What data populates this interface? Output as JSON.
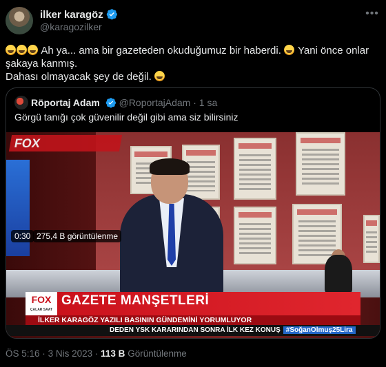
{
  "author": {
    "name": "ilker karagöz",
    "handle": "@karagozilker"
  },
  "tweet": {
    "line1": "Ah ya... ama bir gazeteden okuduğumuz bir haberdi.",
    "line1b": "Yani önce onlar",
    "line2": "şakaya kanmış.",
    "line3": "Dahası olmayacak şey de değil."
  },
  "quoted": {
    "name": "Röportaj Adam",
    "handle": "@RoportajAdam",
    "dot": "·",
    "time": "1 sa",
    "text": "Görgü tanığı çok güvenilir değil gibi ama siz bilirsiniz"
  },
  "video": {
    "bg_logo": "FOX",
    "lower_third_logo": "FOX",
    "lower_third_logo_sub": "ÇALAR SAAT",
    "lower_third_title": "GAZETE MANŞETLERİ",
    "lower_third_sub": "İLKER KARAGÖZ YAZILI BASININ GÜNDEMİNİ YORUMLUYOR",
    "ticker_text": "DEDEN YSK KARARINDAN SONRA İLK KEZ KONUŞ",
    "ticker_hashtag": "#SoğanOlmuş25Lira",
    "duration": "0:30",
    "views": "275,4 B görüntülenme"
  },
  "footer": {
    "time": "ÖS 5:16",
    "sep": "·",
    "date": "3 Nis 2023",
    "sep2": "·",
    "views_count": "113 B",
    "views_label": "Görüntülenme"
  },
  "colors": {
    "background": "#000000",
    "text": "#e7e9ea",
    "muted": "#71767b",
    "verified": "#1d9bf0",
    "border": "#2f3336",
    "fox_red": "#c8101a"
  },
  "icons": [
    "verified-badge-icon",
    "more-icon",
    "laughing-emoji-icon",
    "grinning-emoji-icon"
  ]
}
